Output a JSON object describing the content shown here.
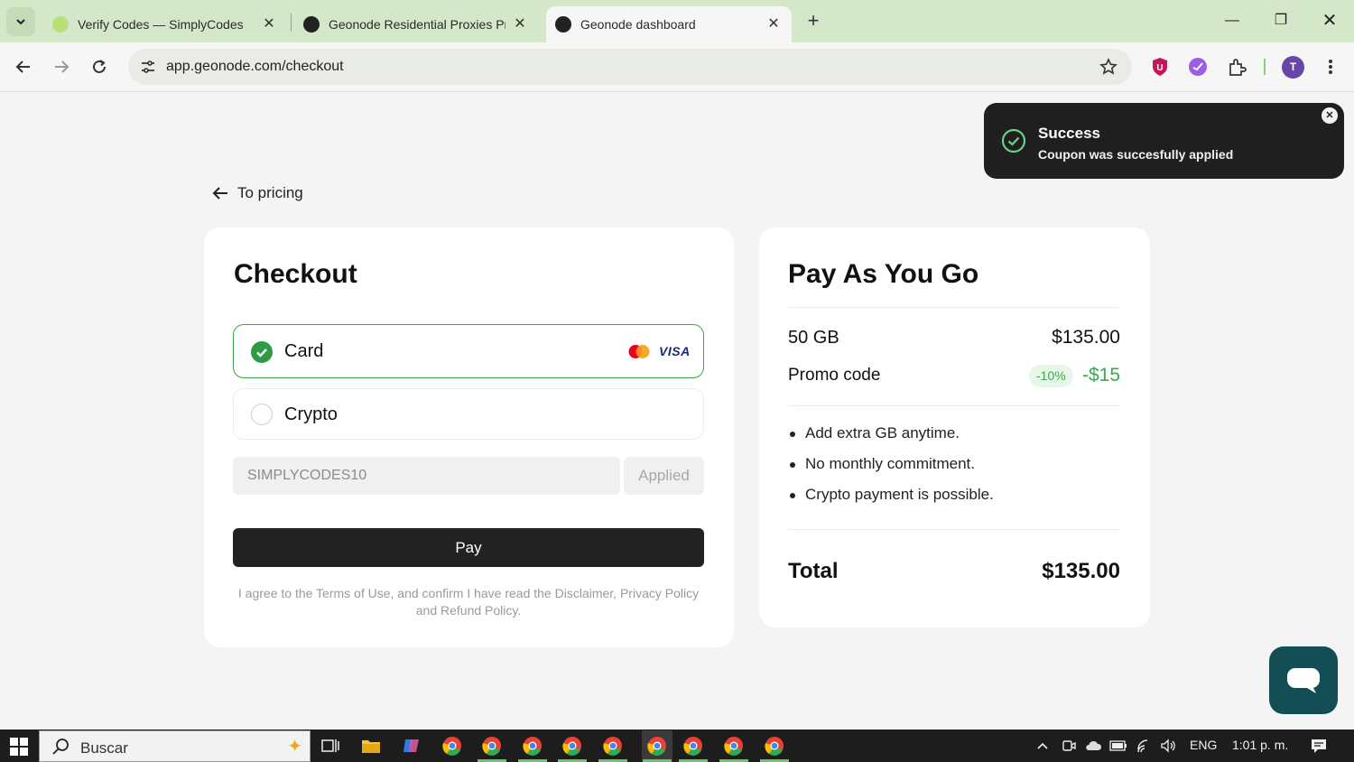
{
  "browser": {
    "tabs": [
      {
        "title": "Verify Codes — SimplyCodes",
        "active": false
      },
      {
        "title": "Geonode Residential Proxies Pr",
        "active": false
      },
      {
        "title": "Geonode dashboard",
        "active": true
      }
    ],
    "url": "app.geonode.com/checkout",
    "profile_initial": "T"
  },
  "page": {
    "back_link": "To pricing",
    "checkout": {
      "title": "Checkout",
      "methods": [
        {
          "label": "Card",
          "selected": true
        },
        {
          "label": "Crypto",
          "selected": false
        }
      ],
      "card_brand_text": "VISA",
      "coupon_value": "SIMPLYCODES10",
      "coupon_button": "Applied",
      "pay_button": "Pay",
      "agreement": "I agree to the Terms of Use, and confirm I have read the Disclaimer, Privacy Policy and Refund Policy."
    },
    "summary": {
      "title": "Pay As You Go",
      "plan_label": "50 GB",
      "plan_price": "$135.00",
      "promo_label": "Promo code",
      "promo_percent": "-10%",
      "promo_amount": "-$15",
      "bullets": [
        "Add extra GB anytime.",
        "No monthly commitment.",
        "Crypto payment is possible."
      ],
      "total_label": "Total",
      "total_value": "$135.00"
    },
    "toast": {
      "title": "Success",
      "message": "Coupon was succesfully applied"
    }
  },
  "taskbar": {
    "search_placeholder": "Buscar",
    "language": "ENG",
    "time": "1:01 p. m."
  },
  "colors": {
    "accent_green": "#39a74a",
    "tab_strip": "#d4e8c9",
    "dark_button": "#222222",
    "chat_button": "#134e54"
  }
}
